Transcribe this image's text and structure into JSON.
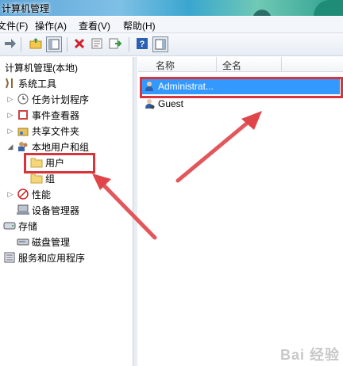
{
  "window": {
    "title": "计算机管理"
  },
  "menu": [
    {
      "label": "文件(F)"
    },
    {
      "label": "操作(A)"
    },
    {
      "label": "查看(V)"
    },
    {
      "label": "帮助(H)"
    }
  ],
  "tree": {
    "root": "计算机管理(本地)",
    "items": [
      {
        "label": "系统工具"
      },
      {
        "label": "任务计划程序"
      },
      {
        "label": "事件查看器"
      },
      {
        "label": "共享文件夹"
      },
      {
        "label": "本地用户和组"
      },
      {
        "label": "用户"
      },
      {
        "label": "组"
      },
      {
        "label": "性能"
      },
      {
        "label": "设备管理器"
      },
      {
        "label": "存储"
      },
      {
        "label": "磁盘管理"
      },
      {
        "label": "服务和应用程序"
      }
    ]
  },
  "list": {
    "columns": [
      "名称",
      "全名"
    ],
    "rows": [
      {
        "name": "Administrat..."
      },
      {
        "name": "Guest"
      }
    ]
  },
  "watermark": "Bai 经验",
  "colors": {
    "highlight": "#d9343a",
    "selection": "#3399ff"
  }
}
